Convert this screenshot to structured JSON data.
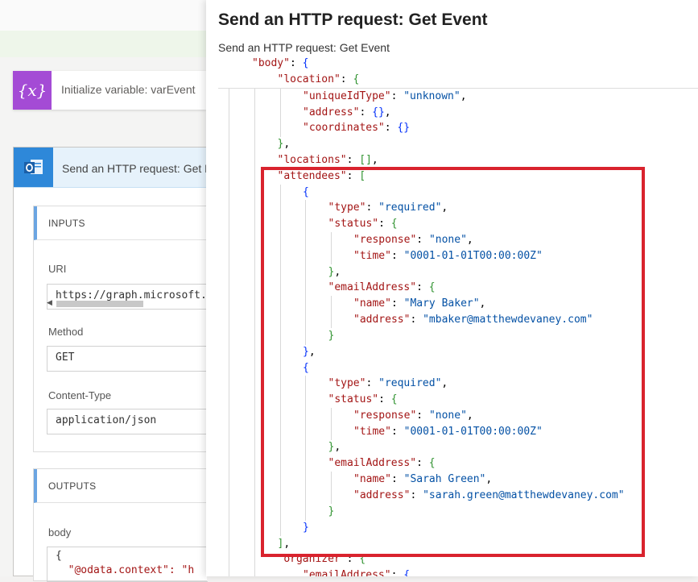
{
  "background": {
    "init_card": {
      "icon": "{x}",
      "icon_name": "variable-icon",
      "title": "Initialize variable: varEvent"
    },
    "http_card": {
      "icon_name": "outlook-icon",
      "title": "Send an HTTP request: Get Event",
      "inputs_header": "INPUTS",
      "uri_label": "URI",
      "uri_value": "https://graph.microsoft.com",
      "method_label": "Method",
      "method_value": "GET",
      "content_type_label": "Content-Type",
      "content_type_value": "application/json",
      "outputs_header": "OUTPUTS",
      "body_label": "body",
      "body_line1": "{",
      "body_line2": "  \"@odata.context\": \"h"
    }
  },
  "panel": {
    "title": "Send an HTTP request: Get Event",
    "subtitle": "Send an HTTP request: Get Event"
  },
  "colors": {
    "highlight": "#d9232e",
    "variable_icon_bg": "#a44bd5",
    "outlook_icon_bg": "#2e88d9"
  },
  "json_lines": [
    "\"body\": {",
    "\"location\": {",
    "\"uniqueIdType\": \"unknown\",",
    "\"address\": {},",
    "\"coordinates\": {}",
    "},",
    "\"locations\": [],",
    "\"attendees\": [",
    "{",
    "\"type\": \"required\",",
    "\"status\": {",
    "\"response\": \"none\",",
    "\"time\": \"0001-01-01T00:00:00Z\"",
    "},",
    "\"emailAddress\": {",
    "\"name\": \"Mary Baker\",",
    "\"address\": \"mbaker@matthewdevaney.com\"",
    "}",
    "},",
    "{",
    "\"type\": \"required\",",
    "\"status\": {",
    "\"response\": \"none\",",
    "\"time\": \"0001-01-01T00:00:00Z\"",
    "},",
    "\"emailAddress\": {",
    "\"name\": \"Sarah Green\",",
    "\"address\": \"sarah.green@matthewdevaney.com\"",
    "}",
    "}",
    "],",
    "\"organizer\": {",
    "\"emailAddress\": {"
  ]
}
